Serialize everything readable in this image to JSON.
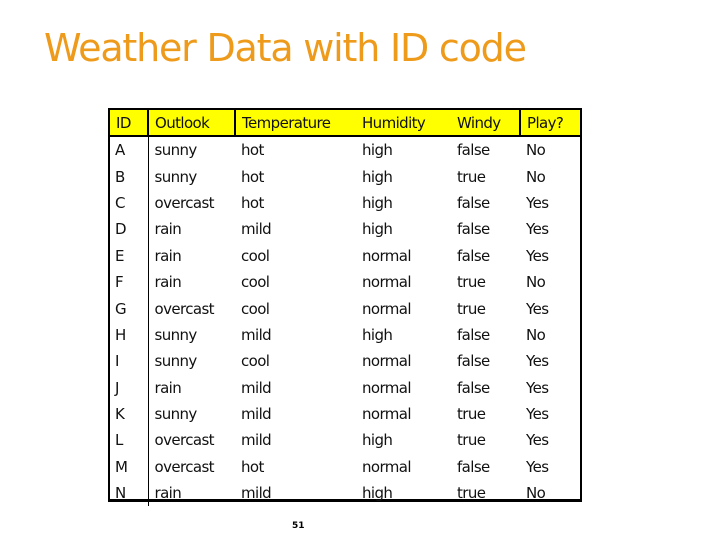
{
  "slide": {
    "title": "Weather Data with ID code",
    "title_color": "#EE9A1A",
    "header_color": "#FFFF00",
    "page_number": "51"
  },
  "table": {
    "columns": [
      "ID",
      "Outlook",
      "Temperature",
      "Humidity",
      "Windy",
      "Play?"
    ],
    "rows": [
      [
        "A",
        "sunny",
        "hot",
        "high",
        "false",
        "No"
      ],
      [
        "B",
        "sunny",
        "hot",
        "high",
        "true",
        "No"
      ],
      [
        "C",
        "overcast",
        "hot",
        "high",
        "false",
        "Yes"
      ],
      [
        "D",
        "rain",
        "mild",
        "high",
        "false",
        "Yes"
      ],
      [
        "E",
        "rain",
        "cool",
        "normal",
        "false",
        "Yes"
      ],
      [
        "F",
        "rain",
        "cool",
        "normal",
        "true",
        "No"
      ],
      [
        "G",
        "overcast",
        "cool",
        "normal",
        "true",
        "Yes"
      ],
      [
        "H",
        "sunny",
        "mild",
        "high",
        "false",
        "No"
      ],
      [
        "I",
        "sunny",
        "cool",
        "normal",
        "false",
        "Yes"
      ],
      [
        "J",
        "rain",
        "mild",
        "normal",
        "false",
        "Yes"
      ],
      [
        "K",
        "sunny",
        "mild",
        "normal",
        "true",
        "Yes"
      ],
      [
        "L",
        "overcast",
        "mild",
        "high",
        "true",
        "Yes"
      ],
      [
        "M",
        "overcast",
        "hot",
        "normal",
        "false",
        "Yes"
      ],
      [
        "N",
        "rain",
        "mild",
        "high",
        "true",
        "No"
      ]
    ]
  }
}
